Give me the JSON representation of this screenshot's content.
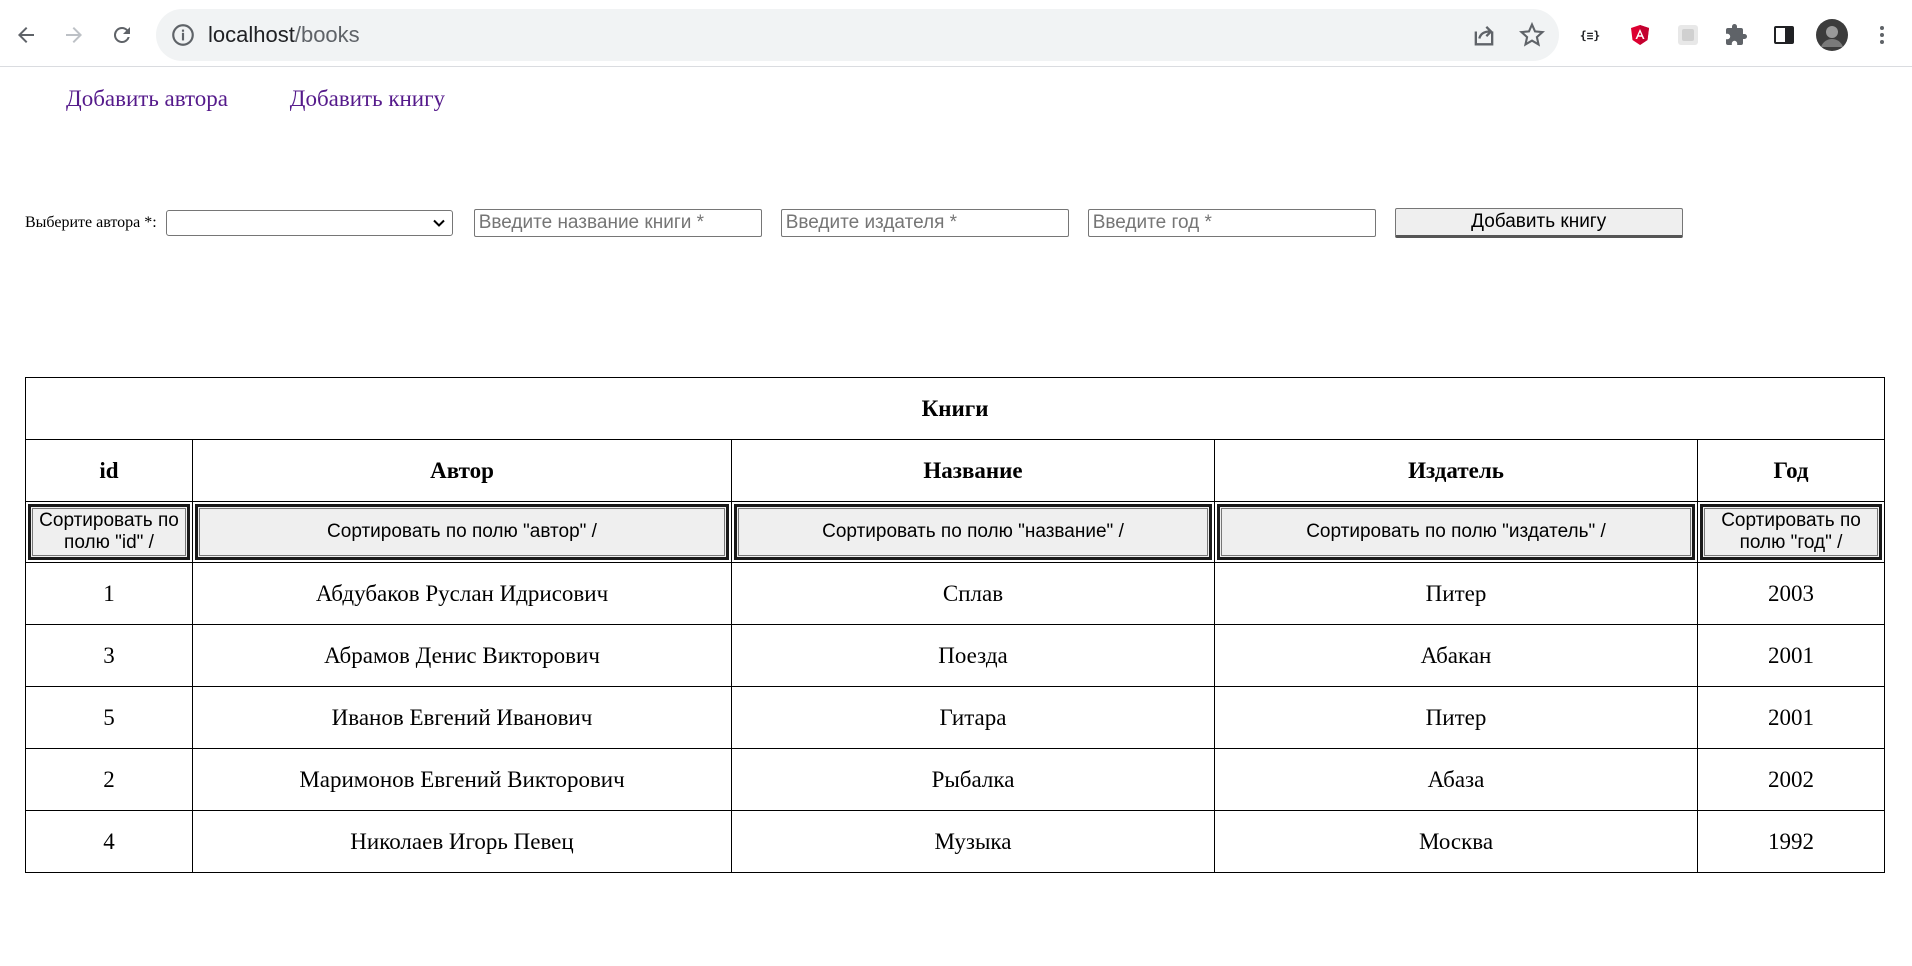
{
  "browser": {
    "url_host": "localhost",
    "url_path": "/books"
  },
  "nav": {
    "add_author": "Добавить автора",
    "add_book": "Добавить книгу"
  },
  "form": {
    "author_label": "Выберите автора *:",
    "author_select_value": "",
    "title_placeholder": "Введите название книги *",
    "publisher_placeholder": "Введите издателя *",
    "year_placeholder": "Введите год *",
    "submit_label": "Добавить книгу"
  },
  "table": {
    "caption": "Книги",
    "headers": [
      "id",
      "Автор",
      "Название",
      "Издатель",
      "Год"
    ],
    "sort_buttons": [
      "Сортировать по полю \"id\" /",
      "Сортировать по полю \"автор\" /",
      "Сортировать по полю \"название\" /",
      "Сортировать по полю \"издатель\" /",
      "Сортировать по полю \"год\" /"
    ],
    "rows": [
      [
        "1",
        "Абдубаков Руслан Идрисович",
        "Сплав",
        "Питер",
        "2003"
      ],
      [
        "3",
        "Абрамов Денис Викторович",
        "Поезда",
        "Абакан",
        "2001"
      ],
      [
        "5",
        "Иванов Евгений Иванович",
        "Гитара",
        "Питер",
        "2001"
      ],
      [
        "2",
        "Маримонов Евгений Викторович",
        "Рыбалка",
        "Абаза",
        "2002"
      ],
      [
        "4",
        "Николаев Игорь Певец",
        "Музыка",
        "Москва",
        "1992"
      ]
    ]
  }
}
